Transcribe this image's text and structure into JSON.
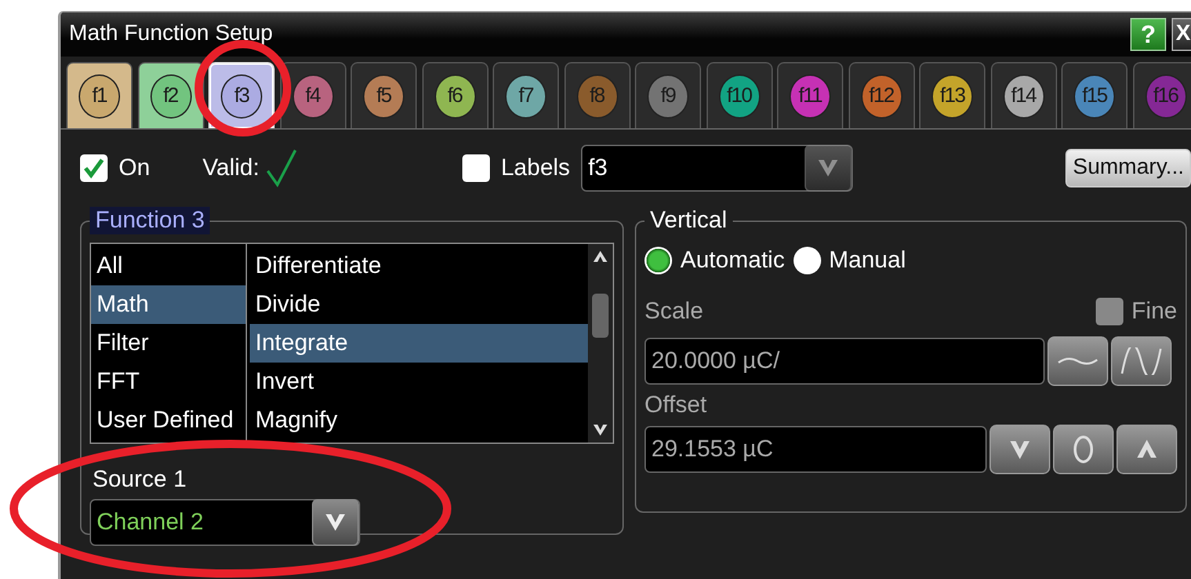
{
  "window": {
    "title": "Math Function Setup",
    "help_button": "?",
    "close_button": "X"
  },
  "tabs": [
    {
      "label": "f1",
      "color": "#c9a86e",
      "on": true,
      "selected": false
    },
    {
      "label": "f2",
      "color": "#72c47f",
      "on": true,
      "selected": false
    },
    {
      "label": "f3",
      "color": "#ababe2",
      "on": true,
      "selected": true
    },
    {
      "label": "f4",
      "color": "#b8637f",
      "on": false,
      "selected": false
    },
    {
      "label": "f5",
      "color": "#b47c55",
      "on": false,
      "selected": false
    },
    {
      "label": "f6",
      "color": "#8fb651",
      "on": false,
      "selected": false
    },
    {
      "label": "f7",
      "color": "#6ea7a6",
      "on": false,
      "selected": false
    },
    {
      "label": "f8",
      "color": "#8a5b2c",
      "on": false,
      "selected": false
    },
    {
      "label": "f9",
      "color": "#737373",
      "on": false,
      "selected": false
    },
    {
      "label": "f10",
      "color": "#12a383",
      "on": false,
      "selected": false
    },
    {
      "label": "f11",
      "color": "#c631b4",
      "on": false,
      "selected": false
    },
    {
      "label": "f12",
      "color": "#c2622a",
      "on": false,
      "selected": false
    },
    {
      "label": "f13",
      "color": "#c4a42a",
      "on": false,
      "selected": false
    },
    {
      "label": "f14",
      "color": "#a8a8a8",
      "on": false,
      "selected": false
    },
    {
      "label": "f15",
      "color": "#4a86b8",
      "on": false,
      "selected": false
    },
    {
      "label": "f16",
      "color": "#852895",
      "on": false,
      "selected": false
    }
  ],
  "on_checkbox": {
    "label": "On",
    "checked": true
  },
  "valid": {
    "label": "Valid:",
    "ok": true
  },
  "labels_checkbox": {
    "label": "Labels",
    "checked": false
  },
  "label_field": {
    "value": "f3"
  },
  "summary_button": "Summary...",
  "function_group": {
    "title": "Function 3",
    "categories": [
      {
        "label": "All",
        "selected": false
      },
      {
        "label": "Math",
        "selected": true
      },
      {
        "label": "Filter",
        "selected": false
      },
      {
        "label": "FFT",
        "selected": false
      },
      {
        "label": "User Defined",
        "selected": false
      }
    ],
    "operators": [
      {
        "label": "Differentiate",
        "selected": false
      },
      {
        "label": "Divide",
        "selected": false
      },
      {
        "label": "Integrate",
        "selected": true
      },
      {
        "label": "Invert",
        "selected": false
      },
      {
        "label": "Magnify",
        "selected": false
      }
    ],
    "source": {
      "label": "Source 1",
      "value": "Channel 2"
    }
  },
  "vertical": {
    "title": "Vertical",
    "modes": [
      {
        "label": "Automatic",
        "selected": true
      },
      {
        "label": "Manual",
        "selected": false
      }
    ],
    "scale_label": "Scale",
    "fine": {
      "label": "Fine",
      "checked": false,
      "disabled": true
    },
    "scale_field": {
      "value": "20.0000 µC/"
    },
    "offset_label": "Offset",
    "offset_field": {
      "value": "29.1553 µC"
    }
  },
  "annotations": [
    {
      "kind": "circle"
    },
    {
      "kind": "ellipse"
    }
  ]
}
